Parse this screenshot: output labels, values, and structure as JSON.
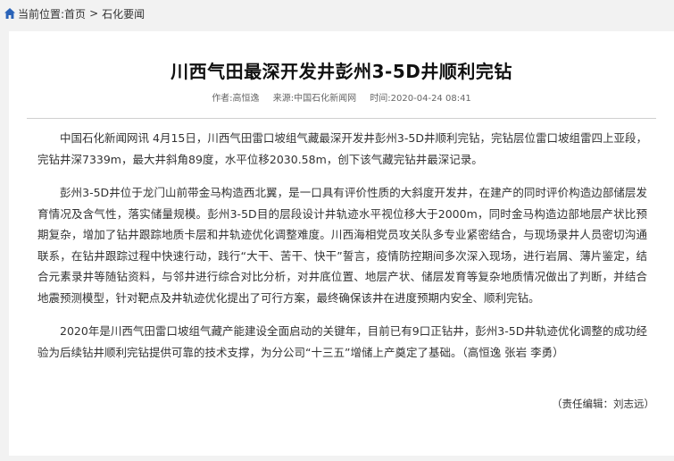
{
  "breadcrumb": {
    "prefix": "当前位置:",
    "home": "首页",
    "separator": ">",
    "section": "石化要闻"
  },
  "article": {
    "title": "川西气田最深开发井彭州3-5D井顺利完钻",
    "author": "作者:高恒逸",
    "source": "来源:中国石化新闻网",
    "time": "时间:2020-04-24 08:41",
    "paragraphs": [
      "中国石化新闻网讯 4月15日，川西气田雷口坡组气藏最深开发井彭州3-5D井顺利完钻，完钻层位雷口坡组雷四上亚段，完钻井深7339m，最大井斜角89度，水平位移2030.58m，创下该气藏完钻井最深记录。",
      "彭州3-5D井位于龙门山前带金马构造西北翼，是一口具有评价性质的大斜度开发井，在建产的同时评价构造边部储层发育情况及含气性，落实储量规模。彭州3-5D目的层段设计井轨迹水平视位移大于2000m，同时金马构造边部地层产状比预期复杂，增加了钻井跟踪地质卡层和井轨迹优化调整难度。川西海相党员攻关队多专业紧密结合，与现场录井人员密切沟通联系，在钻井跟踪过程中快速行动，践行“大干、苦干、快干”誓言，疫情防控期间多次深入现场，进行岩屑、薄片鉴定，结合元素录井等随钻资料，与邻井进行综合对比分析，对井底位置、地层产状、储层发育等复杂地质情况做出了判断，并结合地震预测模型，针对靶点及井轨迹优化提出了可行方案，最终确保该井在进度预期内安全、顺利完钻。",
      "2020年是川西气田雷口坡组气藏产能建设全面启动的关键年，目前已有9口正钻井，彭州3-5D井轨迹优化调整的成功经验为后续钻井顺利完钻提供可靠的技术支撑，为分公司“十三五”增储上产奠定了基础。（高恒逸 张岩 李勇）"
    ],
    "editor": "（责任编辑：刘志远）"
  },
  "colors": {
    "home_icon": "#2a63b8",
    "page_bg": "#f2f2f2",
    "card_bg": "#ffffff"
  }
}
